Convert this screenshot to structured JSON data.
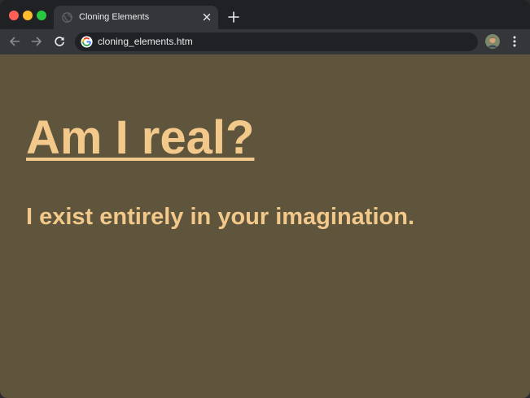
{
  "browser": {
    "tab": {
      "title": "Cloning Elements",
      "favicon": "globe-icon"
    },
    "address_bar": {
      "url": "cloning_elements.htm",
      "icon": "google-g-icon"
    },
    "colors": {
      "frame": "#202124",
      "toolbar": "#35363a",
      "omnibox": "#202124"
    }
  },
  "page": {
    "headline": "Am I real?",
    "subline": "I exist entirely in your imagination.",
    "colors": {
      "background": "#5f543c",
      "text": "#f2c98a"
    }
  }
}
